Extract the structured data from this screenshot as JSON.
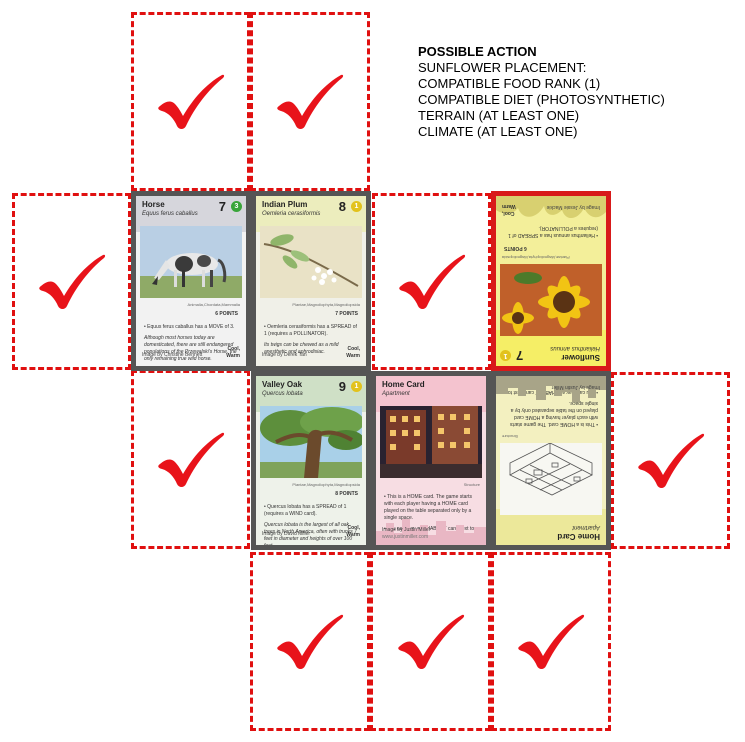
{
  "info": {
    "title": "POSSIBLE ACTION",
    "lines": [
      "SUNFLOWER PLACEMENT:",
      "COMPATIBLE FOOD RANK (1)",
      "COMPATIBLE DIET (PHOTOSYNTHETIC)",
      "TERRAIN (AT LEAST ONE)",
      "CLIMATE (AT LEAST ONE)"
    ]
  },
  "colors": {
    "slot_border": "#e01010",
    "check": "#e8131a",
    "card_border": "#555555",
    "highlight_border": "#d81a1a"
  },
  "cards": {
    "horse": {
      "name": "Horse",
      "latin": "Equus ferus caballus",
      "rank": "7",
      "badge": "3",
      "taxa": "Animalia,Chordata,Mammalia",
      "points": "6 POINTS",
      "text1": "• Equus ferus caballus has a MOVE of 3.",
      "text2": "Although most horses today are domesticated, there are still endangered populations of the Przewalski's Horse, the only remaining true wild horse.",
      "credit": "Image by Christine Bennett",
      "climate": "Cool, Warm"
    },
    "plum": {
      "name": "Indian Plum",
      "latin": "Oemleria cerasiformis",
      "rank": "8",
      "badge": "1",
      "taxa": "Plantae,Magnoliophyta,Magnoliopsida",
      "points": "7 POINTS",
      "text1": "• Oemleria cerasiformis has a SPREAD of 1 (requires a POLLINATOR).",
      "text2": "Its twigs can be chewed as a mild anesthetic and aphrodisiac.",
      "credit": "Image by Derek Tan",
      "climate": "Cool, Warm"
    },
    "sunflower": {
      "name": "Sunflower",
      "latin": "Helianthus annuus",
      "rank": "7",
      "badge": "1",
      "taxa": "Plantae,Magnoliophyta,Magnoliopsida",
      "points": "6 POINTS",
      "text1": "• Helianthus annuus has a SPREAD of 1 (requires a POLLINATOR).",
      "credit": "Image by Jessie Mackie",
      "climate": "Cool, Warm"
    },
    "oak": {
      "name": "Valley Oak",
      "latin": "Quercus lobata",
      "rank": "9",
      "badge": "1",
      "taxa": "Plantae,Magnoliophyta,Magnoliopsida",
      "points": "8 POINTS",
      "text1": "• Quercus lobata has a SPREAD of 1 (requires a WIND card).",
      "text2": "Quercus lobata is the largest of all oak trees in North America, often with trunks 7 feet in diameter and heights of over 100 feet.",
      "credit": "Image by David Miller",
      "climate": "Cool, Warm"
    },
    "home1": {
      "name": "Home Card",
      "latin": "Apartment",
      "tag": "Structure",
      "text1": "• This is a HOME card. The game starts with each player having a HOME card played on the table separated only by a single space.",
      "text2": "• You can play any HABITAT card next to your HOME card.",
      "credit": "Image by Justin Miller",
      "url": "www.justinmiller.com"
    },
    "home2": {
      "name": "Home Card",
      "latin": "Apartment",
      "tag": "Structure",
      "text1": "• This is a HOME card. The game starts with each player having a HOME card played on the table separated only by a single space.",
      "text2": "• You can play any HABITAT card next to your HOME card.",
      "credit": "Image by Justin Miller"
    }
  }
}
